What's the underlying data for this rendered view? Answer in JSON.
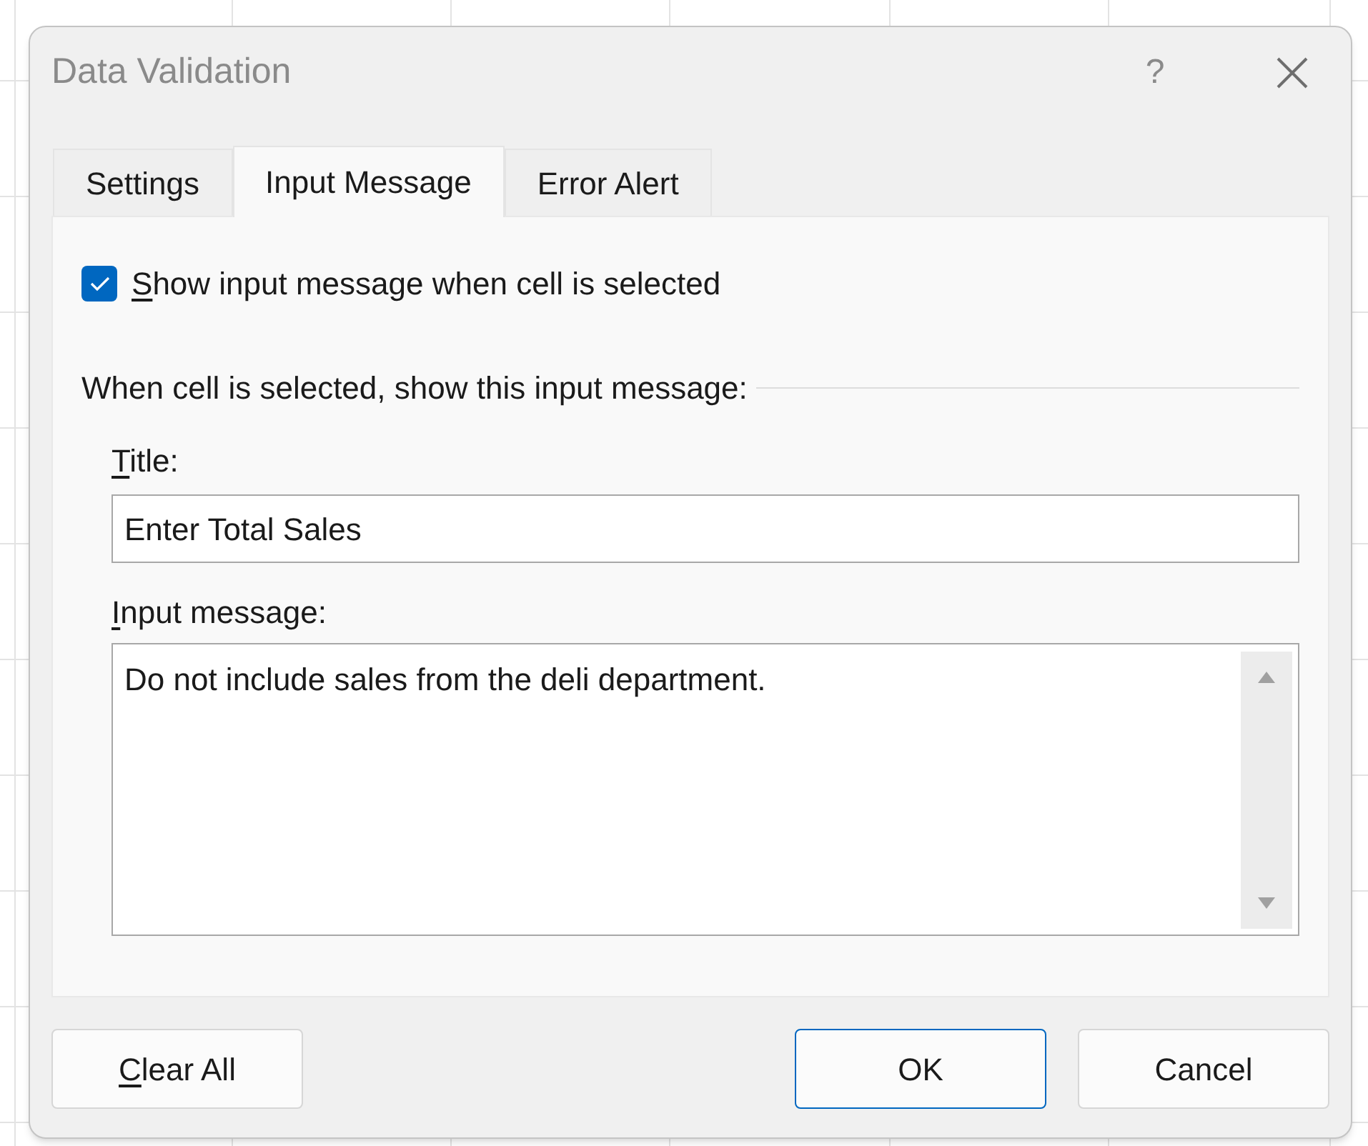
{
  "window": {
    "title": "Data Validation",
    "help": "?"
  },
  "tabs": [
    {
      "label": "Settings",
      "selected": false
    },
    {
      "label": "Input Message",
      "selected": true
    },
    {
      "label": "Error Alert",
      "selected": false
    }
  ],
  "show_message": {
    "label": "Show input message when cell is selected",
    "checked": true,
    "underline_first": true
  },
  "group_label": "When cell is selected, show this input message:",
  "title_field": {
    "label": "Title:",
    "underline_first": true,
    "value": "Enter Total Sales"
  },
  "message_field": {
    "label": "Input message:",
    "underline_first": true,
    "value": "Do not include sales from the deli department."
  },
  "buttons": [
    {
      "label": "Clear All",
      "underline_first": true,
      "default": false
    },
    {
      "label": "OK",
      "underline_first": false,
      "default": true
    },
    {
      "label": "Cancel",
      "underline_first": false,
      "default": false
    }
  ]
}
